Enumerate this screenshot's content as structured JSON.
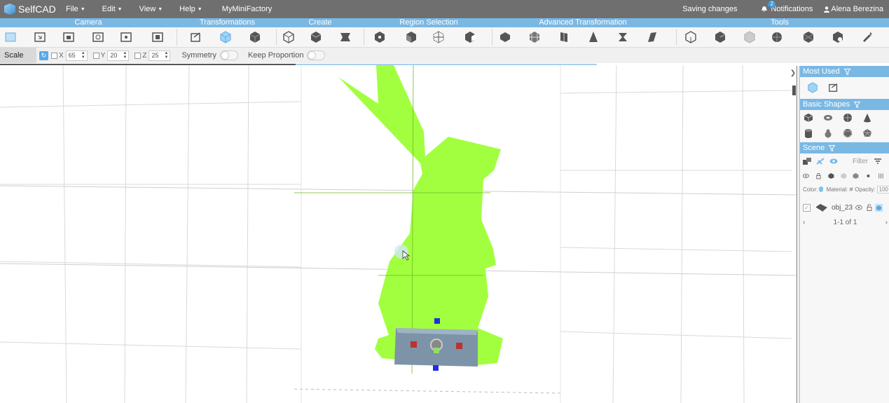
{
  "app": {
    "logo_text": "SelfCAD",
    "menu": [
      {
        "label": "File"
      },
      {
        "label": "Edit"
      },
      {
        "label": "View"
      },
      {
        "label": "Help"
      }
    ],
    "menu_link": "MyMiniFactory",
    "status": "Saving changes",
    "notifications_label": "Notifications",
    "notifications_count": "2",
    "user_name": "Alena Berezina"
  },
  "categories": [
    "Camera",
    "Transformations",
    "Create",
    "Region Selection",
    "Advanced Transformation",
    "Tools"
  ],
  "options": {
    "mode_label": "Scale (L)",
    "x_label": "X",
    "x_value": "65",
    "y_label": "Y",
    "y_value": "20",
    "z_label": "Z",
    "z_value": "25",
    "symmetry_label": "Symmetry",
    "keep_proportion_label": "Keep Proportion"
  },
  "sidebar": {
    "most_used_title": "Most Used",
    "basic_shapes_title": "Basic Shapes",
    "scene_title": "Scene",
    "filter_placeholder": "Filter",
    "color_label": "Color:",
    "material_label": "Material:",
    "opacity_label": "Opacity:",
    "opacity_value": "100",
    "object_name": "obj_23",
    "pager_text": "1-1 of 1"
  },
  "colors": {
    "accent": "#7ab8e4",
    "topbar": "#6f6f6f",
    "bunny": "#a2ff3f"
  }
}
